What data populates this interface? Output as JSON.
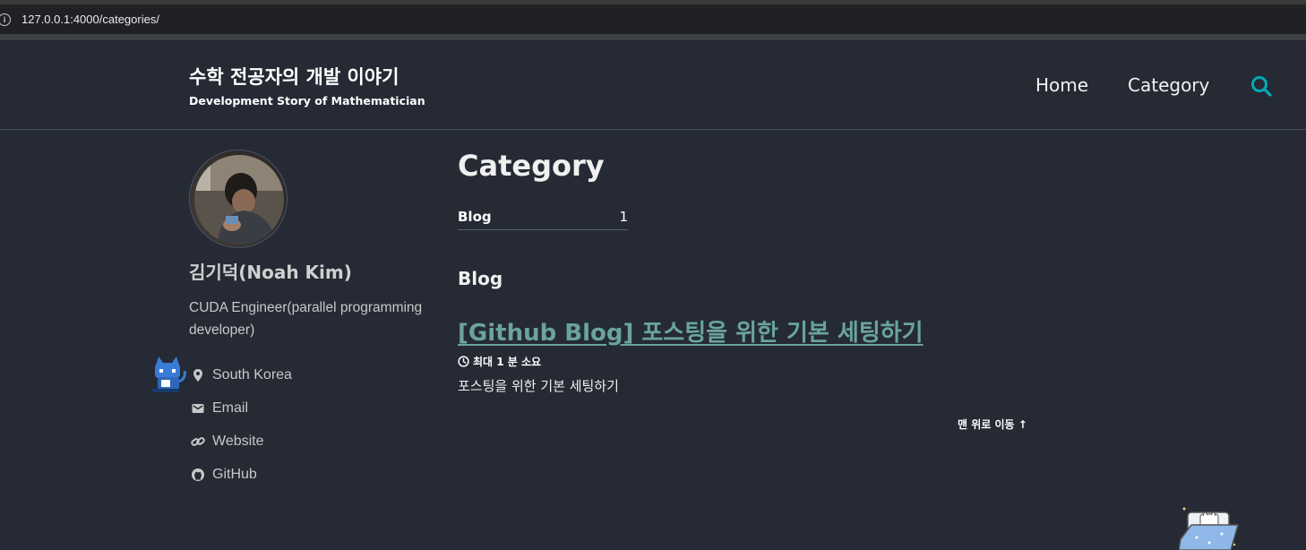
{
  "browser": {
    "url": "127.0.0.1:4000/categories/"
  },
  "masthead": {
    "title": "수학 전공자의 개발 이야기",
    "subtitle": "Development Story of Mathematician",
    "nav": [
      {
        "label": "Home"
      },
      {
        "label": "Category"
      }
    ],
    "search_icon": "search-icon"
  },
  "author": {
    "name": "김기덕(Noah Kim)",
    "bio": "CUDA Engineer(parallel programming developer)",
    "links": [
      {
        "label": "South Korea",
        "icon": "location-pin-icon"
      },
      {
        "label": "Email",
        "icon": "envelope-icon"
      },
      {
        "label": "Website",
        "icon": "link-icon"
      },
      {
        "label": "GitHub",
        "icon": "github-icon"
      }
    ]
  },
  "main": {
    "page_title": "Category",
    "taxonomy_index": [
      {
        "name": "Blog",
        "count": "1"
      }
    ],
    "sections": [
      {
        "heading": "Blog",
        "posts": [
          {
            "title": "[Github Blog] 포스팅을 위한 기본 세팅하기",
            "read_time": "최대 1 분 소요",
            "excerpt": "포스팅을 위한 기본 세팅하기"
          }
        ]
      }
    ],
    "back_to_top": "맨 위로 이동 ↑"
  },
  "colors": {
    "background": "#252a34",
    "link": "#6aa39f",
    "search_accent": "#00adb5"
  }
}
